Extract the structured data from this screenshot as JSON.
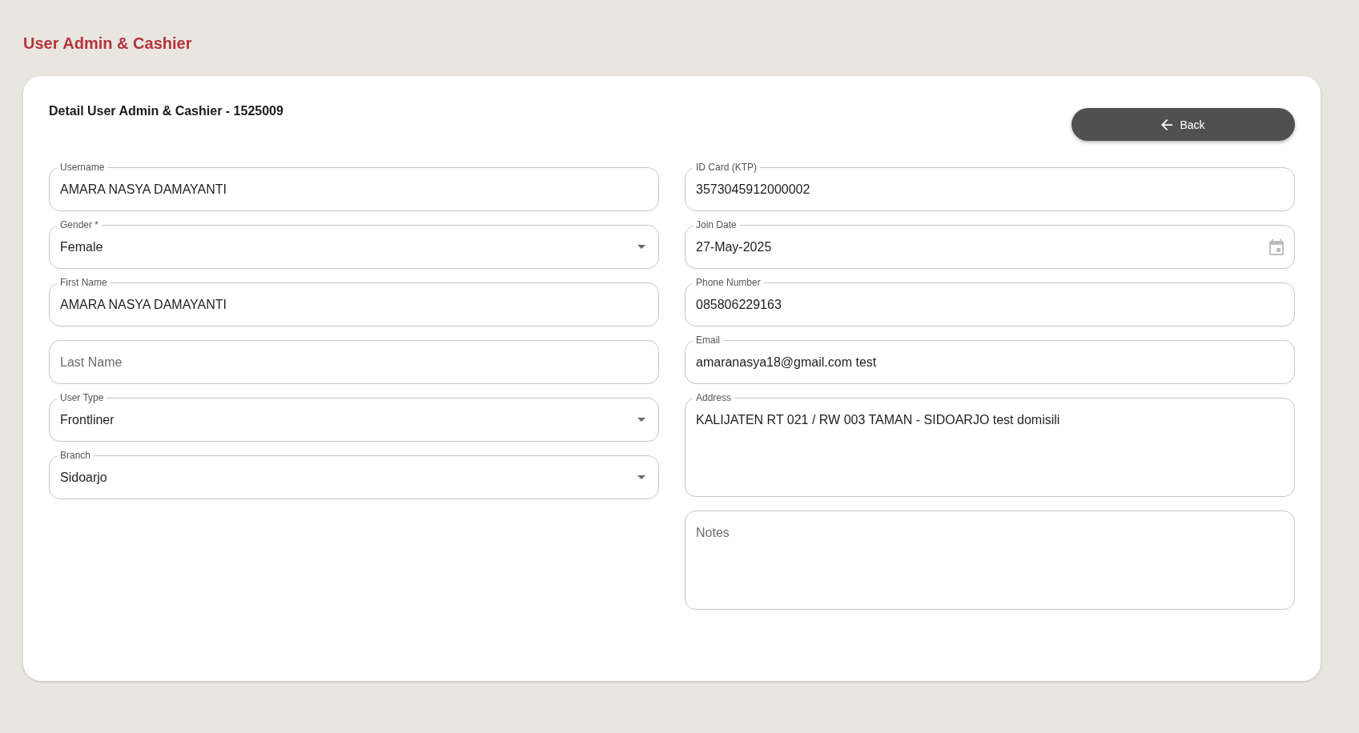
{
  "page_title": "User Admin & Cashier",
  "card": {
    "title": "Detail User Admin & Cashier - 1525009",
    "back_button": {
      "label": "Back"
    }
  },
  "left_fields": [
    {
      "kind": "text",
      "label": "Username",
      "value": "AMARA NASYA DAMAYANTI"
    },
    {
      "kind": "select",
      "label": "Gender *",
      "value": "Female"
    },
    {
      "kind": "text",
      "label": "First Name",
      "value": "AMARA NASYA DAMAYANTI"
    },
    {
      "kind": "text",
      "placeholder": "Last Name"
    },
    {
      "kind": "select",
      "label": "User Type",
      "value": "Frontliner"
    },
    {
      "kind": "select",
      "label": "Branch",
      "value": "Sidoarjo"
    }
  ],
  "right_fields": [
    {
      "kind": "text",
      "label": "ID Card (KTP)",
      "value": "3573045912000002"
    },
    {
      "kind": "date",
      "label": "Join Date",
      "value": "27-May-2025"
    },
    {
      "kind": "text",
      "label": "Phone Number",
      "value": "085806229163"
    },
    {
      "kind": "text",
      "label": "Email",
      "value": "amaranasya18@gmail.com test"
    },
    {
      "kind": "textarea",
      "label": "Address",
      "value": "KALIJATEN RT 021 / RW 003 TAMAN - SIDOARJO test domisili"
    },
    {
      "kind": "textarea",
      "placeholder": "Notes"
    }
  ]
}
